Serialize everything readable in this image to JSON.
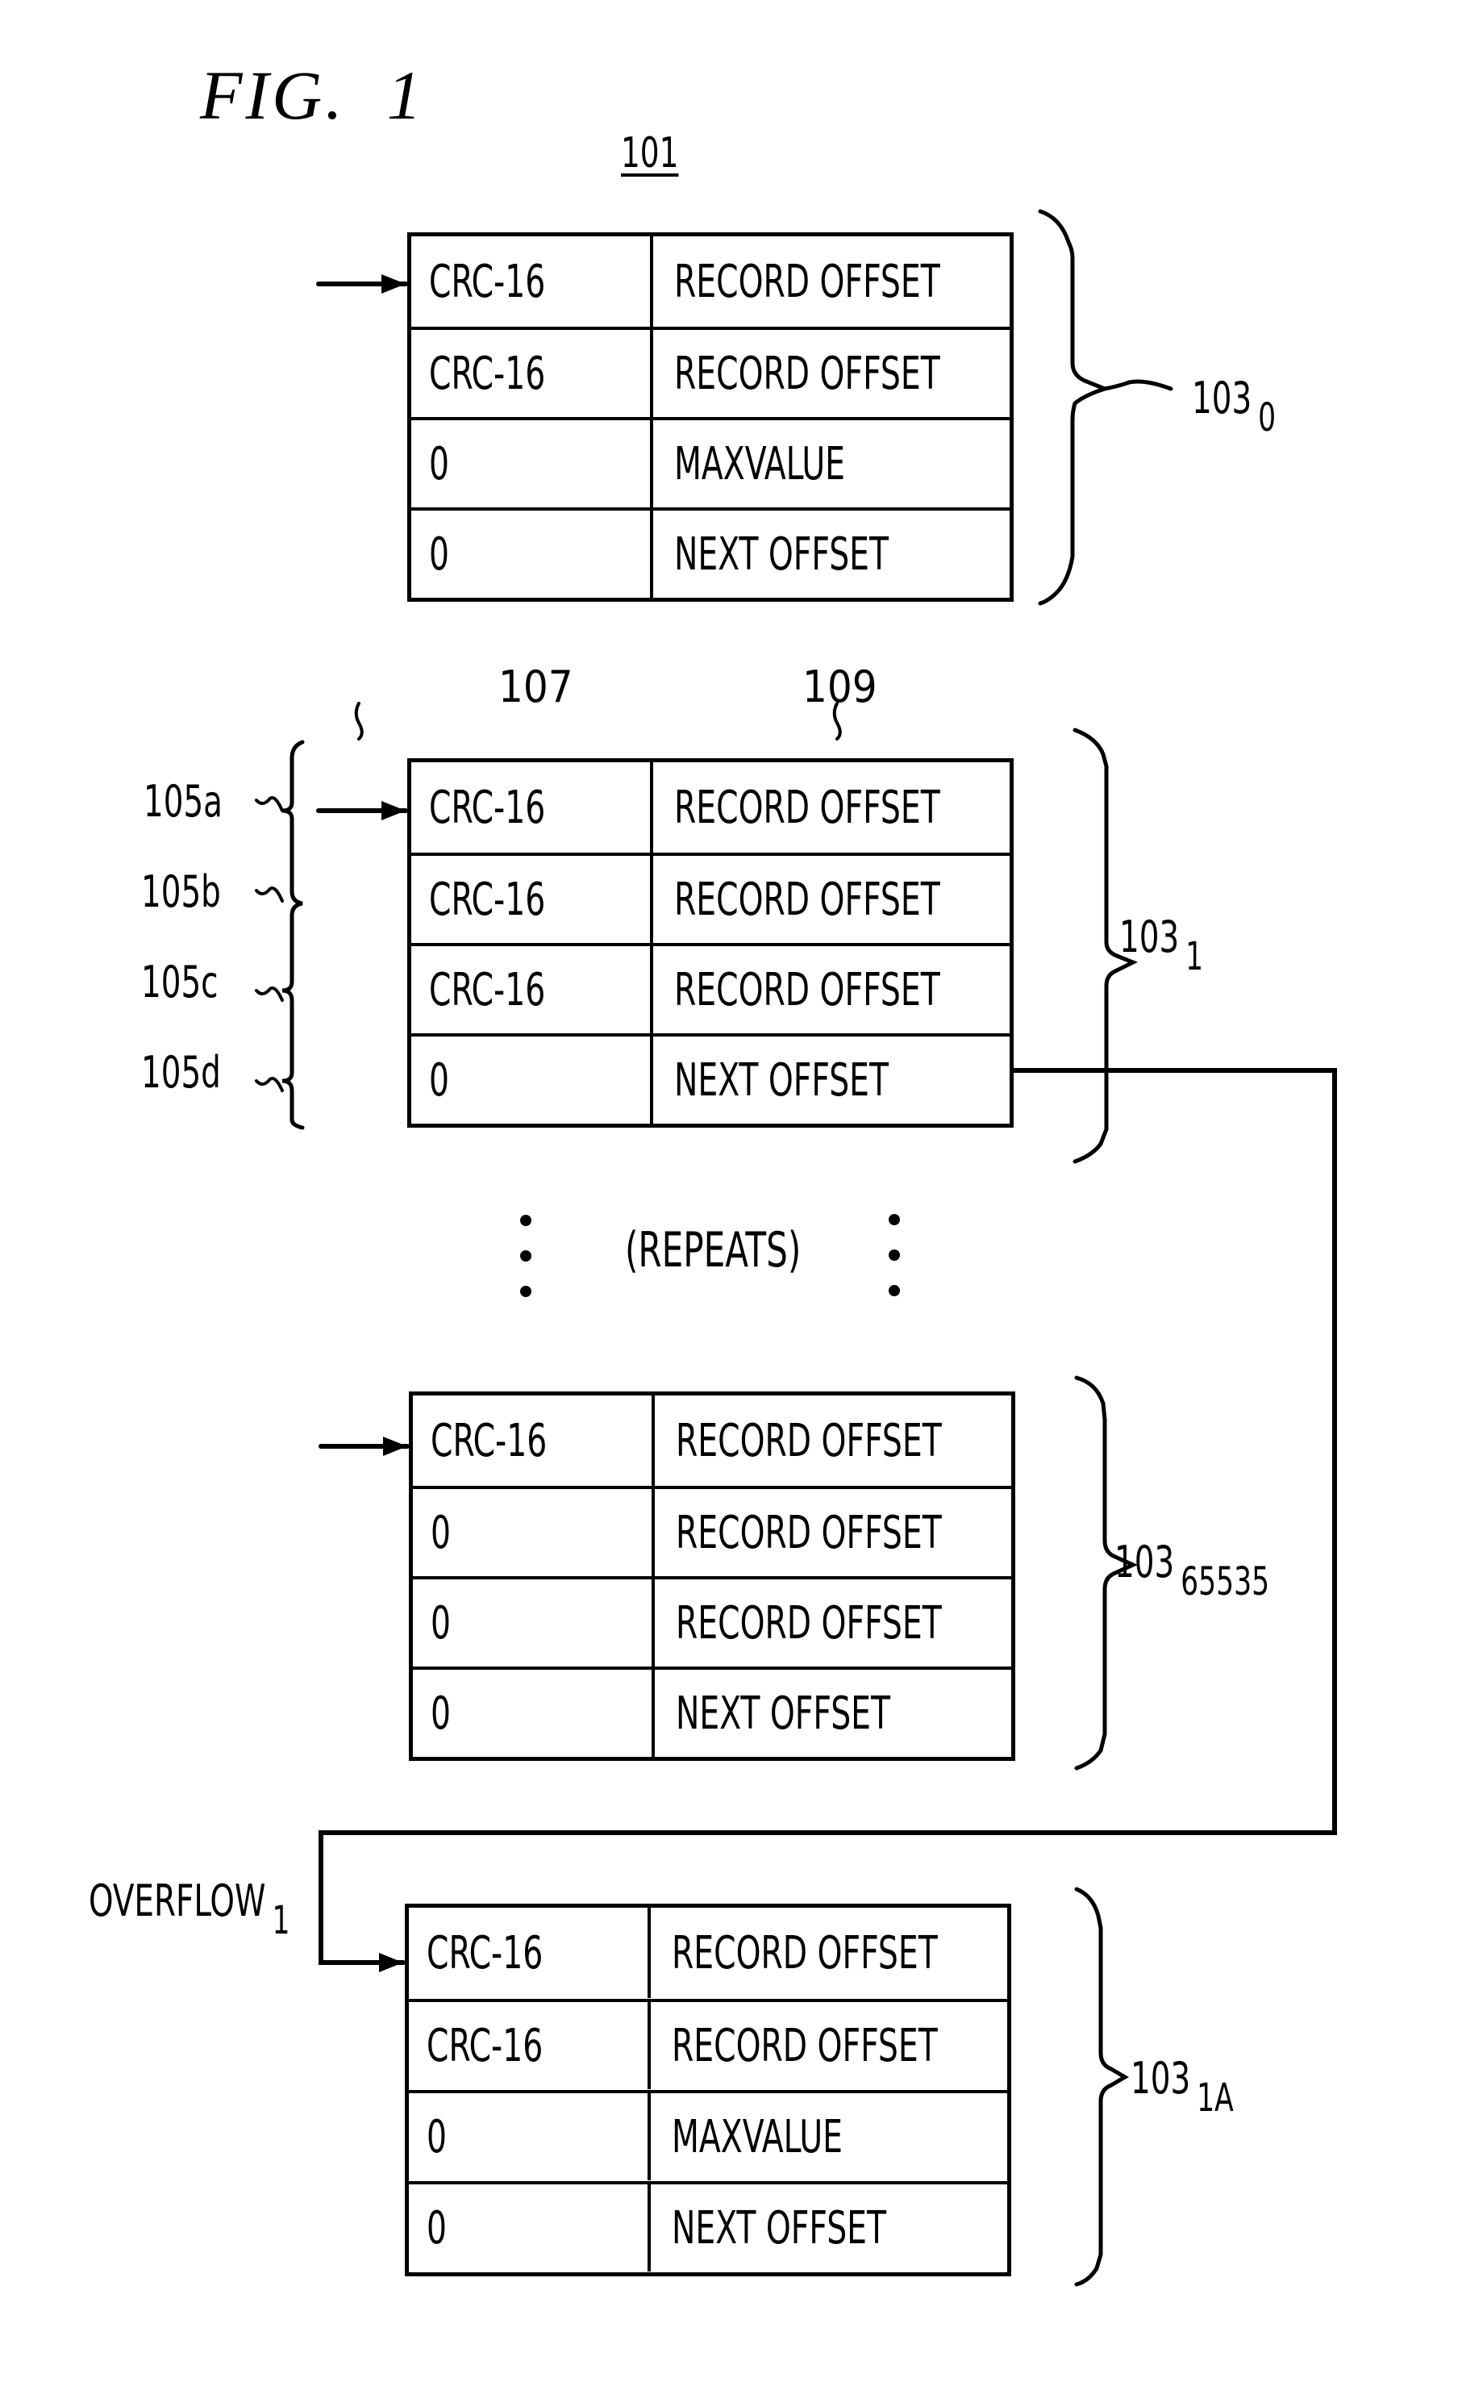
{
  "figure": {
    "title": "FIG.  1",
    "reference": "101"
  },
  "column_refs": {
    "crc_column": "107",
    "offset_column": "109"
  },
  "repeats_label": "(REPEATS)",
  "overflow_label": {
    "text": "OVERFLOW",
    "subscript": "1"
  },
  "entry_labels": [
    "105a",
    "105b",
    "105c",
    "105d"
  ],
  "blocks": [
    {
      "label": "103",
      "subscript": "0",
      "rows": [
        {
          "left": "CRC-16",
          "right": "RECORD OFFSET"
        },
        {
          "left": "CRC-16",
          "right": "RECORD OFFSET"
        },
        {
          "left": "0",
          "right": "MAXVALUE"
        },
        {
          "left": "0",
          "right": "NEXT OFFSET"
        }
      ]
    },
    {
      "label": "103",
      "subscript": "1",
      "rows": [
        {
          "left": "CRC-16",
          "right": "RECORD OFFSET"
        },
        {
          "left": "CRC-16",
          "right": "RECORD OFFSET"
        },
        {
          "left": "CRC-16",
          "right": "RECORD OFFSET"
        },
        {
          "left": "0",
          "right": "NEXT OFFSET"
        }
      ]
    },
    {
      "label": "103",
      "subscript": "65535",
      "rows": [
        {
          "left": "CRC-16",
          "right": "RECORD OFFSET"
        },
        {
          "left": "0",
          "right": "RECORD OFFSET"
        },
        {
          "left": "0",
          "right": "RECORD OFFSET"
        },
        {
          "left": "0",
          "right": "NEXT OFFSET"
        }
      ]
    },
    {
      "label": "103",
      "subscript": "1A",
      "rows": [
        {
          "left": "CRC-16",
          "right": "RECORD OFFSET"
        },
        {
          "left": "CRC-16",
          "right": "RECORD OFFSET"
        },
        {
          "left": "0",
          "right": "MAXVALUE"
        },
        {
          "left": "0",
          "right": "NEXT OFFSET"
        }
      ]
    }
  ]
}
